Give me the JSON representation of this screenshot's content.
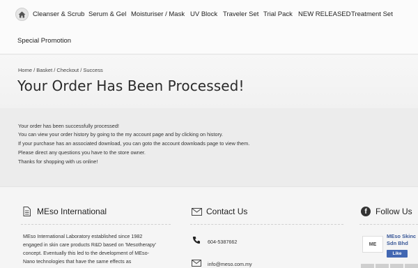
{
  "nav": {
    "items": [
      "Cleanser & Scrub",
      "Serum & Gel",
      "Moisturiser / Mask",
      "UV Block",
      "Traveler Set",
      "Trial Pack",
      "NEW RELEASED",
      "Treatment Set"
    ],
    "row2_item": "Special Promotion"
  },
  "breadcrumb": "Home / Basket / Checkout / Success",
  "title": "Your Order Has Been Processed!",
  "messages": [
    "Your order has been successfully processed!",
    "You can view your order history by going to the my account page and by clicking on history.",
    "If your purchase has an associated download, you can goto the account downloads page to view them.",
    "Please direct any questions you have to the store owner.",
    "Thanks for shopping with us online!"
  ],
  "footer": {
    "about": {
      "title": "MEso International",
      "lines": [
        "MEso International Laboratory established since 1982",
        "engaged in skin care products R&D based on 'Mesotherapy'",
        "concept. Eventually this led to the development of MEso-",
        "Nano technologies that have the same effects as"
      ]
    },
    "contact": {
      "title": "Contact Us",
      "phone": "604-5387662",
      "email": "info@meso.com.my"
    },
    "follow": {
      "title": "Follow Us",
      "page_name_1": "MEso Skinc",
      "page_name_2": "Sdn Bhd",
      "like_label": "Like",
      "logo_text": "ME"
    }
  },
  "colors": {
    "facebook": "#3b5998",
    "like_button": "#4267b2"
  }
}
